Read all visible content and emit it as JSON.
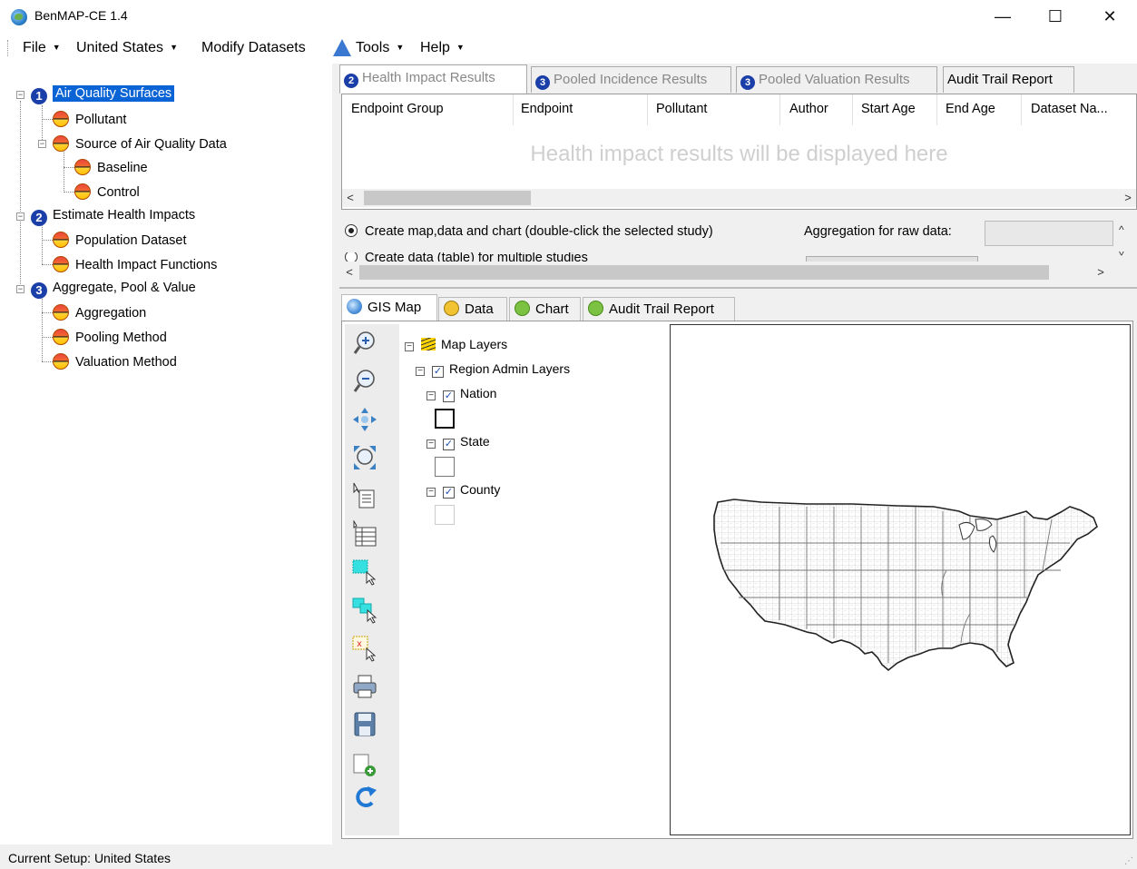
{
  "window": {
    "title": "BenMAP-CE 1.4",
    "minimize": "—",
    "maximize": "☐",
    "close": "✕"
  },
  "menu": {
    "file": "File",
    "region": "United States",
    "modify": "Modify Datasets",
    "tools": "Tools",
    "help": "Help"
  },
  "tree": {
    "step1": {
      "num": "1",
      "label": "Air Quality Surfaces"
    },
    "pollutant": "Pollutant",
    "source": "Source of Air Quality Data",
    "baseline": "Baseline",
    "control": "Control",
    "step2": {
      "num": "2",
      "label": "Estimate Health Impacts"
    },
    "population": "Population Dataset",
    "hif": "Health Impact Functions",
    "step3": {
      "num": "3",
      "label": "Aggregate, Pool & Value"
    },
    "aggregation": "Aggregation",
    "pooling": "Pooling Method",
    "valuation": "Valuation Method"
  },
  "results_tabs": [
    {
      "num": "2",
      "label": "Health Impact Results"
    },
    {
      "num": "3",
      "label": "Pooled Incidence Results"
    },
    {
      "num": "3",
      "label": "Pooled Valuation Results"
    },
    {
      "label": "Audit Trail Report"
    }
  ],
  "grid": {
    "columns": [
      "Endpoint Group",
      "Endpoint",
      "Pollutant",
      "Author",
      "Start Age",
      "End Age",
      "Dataset Na..."
    ],
    "empty_message": "Health impact results will be displayed here"
  },
  "options": {
    "radio1": "Create map,data and chart (double-click the selected study)",
    "radio2": "Create data (table) for multiple studies",
    "aggregation_label": "Aggregation for raw data:"
  },
  "view_tabs": [
    "GIS Map",
    "Data",
    "Chart",
    "Audit Trail Report"
  ],
  "layers": {
    "root": "Map Layers",
    "group": "Region Admin Layers",
    "nation": "Nation",
    "state": "State",
    "county": "County"
  },
  "status": {
    "text": "Current Setup: United States"
  }
}
